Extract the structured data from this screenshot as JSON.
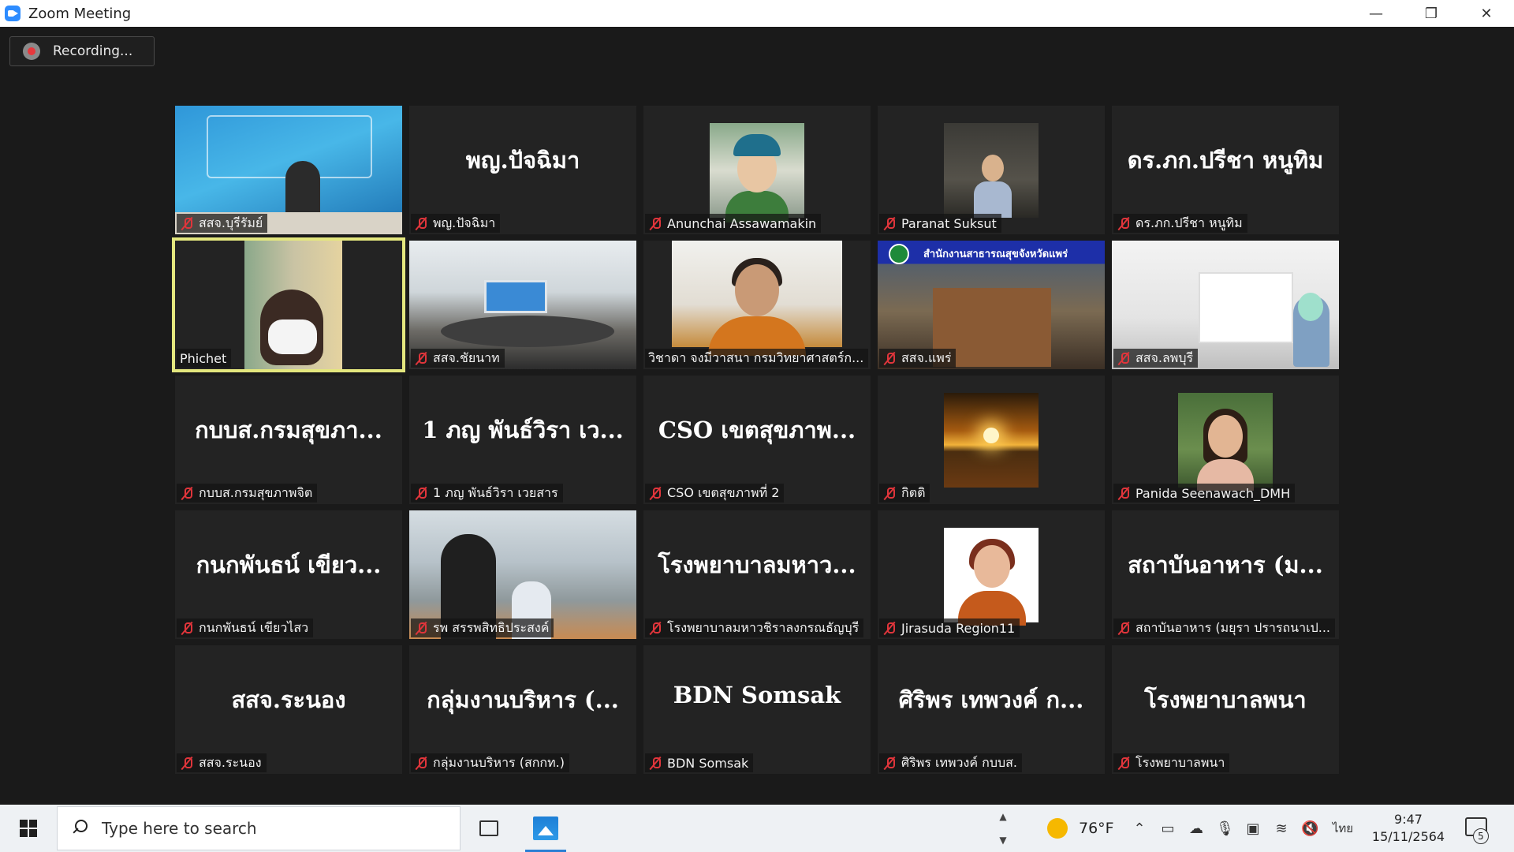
{
  "window": {
    "title": "Zoom Meeting",
    "controls": {
      "minimize": "—",
      "restore": "❐",
      "close": "✕"
    }
  },
  "recording": {
    "label": "Recording..."
  },
  "participants": [
    {
      "display": "",
      "label": "สสจ.บุรีรัมย์",
      "muted": true,
      "video": "phec"
    },
    {
      "display": "พญ.ปัจฉิมา",
      "label": "พญ.ปัจฉิมา",
      "muted": true,
      "video": "none"
    },
    {
      "display": "",
      "label": "Anunchai Assawamakin",
      "muted": true,
      "video": "face"
    },
    {
      "display": "",
      "label": "Paranat Suksut",
      "muted": true,
      "video": "board"
    },
    {
      "display": "ดร.ภก.ปรีชา หนูทิม",
      "label": "ดร.ภก.ปรีชา หนูทิม",
      "muted": true,
      "video": "none"
    },
    {
      "display": "",
      "label": "Phichet",
      "muted": false,
      "video": "phichet",
      "active": true
    },
    {
      "display": "",
      "label": "สสจ.ชัยนาท",
      "muted": true,
      "video": "room1"
    },
    {
      "display": "",
      "label": "วิชาดา จงมีวาสนา กรมวิทยาศาสตร์ก...",
      "muted": false,
      "video": "woman"
    },
    {
      "display": "",
      "label": "สสจ.แพร่",
      "muted": true,
      "video": "room2"
    },
    {
      "display": "",
      "label": "สสจ.ลพบุรี",
      "muted": true,
      "video": "room3"
    },
    {
      "display": "กบบส.กรมสุขภา...",
      "label": "กบบส.กรมสุขภาพจิต",
      "muted": true,
      "video": "none"
    },
    {
      "display": "1 ภญ พันธ์วิรา เว...",
      "label": "1 ภญ พันธ์วิรา เวยสาร",
      "muted": true,
      "video": "none"
    },
    {
      "display": "CSO เขตสุขภาพ...",
      "label": "CSO เขตสุขภาพที่ 2",
      "muted": true,
      "video": "none"
    },
    {
      "display": "",
      "label": "กิตติ",
      "muted": true,
      "video": "sunset"
    },
    {
      "display": "",
      "label": "Panida Seenawach_DMH",
      "muted": true,
      "video": "panida"
    },
    {
      "display": "กนกพันธน์ เขียว...",
      "label": "กนกพันธน์ เขียวไสว",
      "muted": true,
      "video": "none"
    },
    {
      "display": "",
      "label": "รพ สรรพสิทธิประสงค์",
      "muted": true,
      "video": "office"
    },
    {
      "display": "โรงพยาบาลมหาว...",
      "label": "โรงพยาบาลมหาวชิราลงกรณธัญบุรี",
      "muted": true,
      "video": "none"
    },
    {
      "display": "",
      "label": "Jirasuda Region11",
      "muted": true,
      "video": "jirasuda"
    },
    {
      "display": "สถาบันอาหาร (ม...",
      "label": "สถาบันอาหาร (มยุรา ปรารถนาเป...",
      "muted": true,
      "video": "none"
    },
    {
      "display": "สสจ.ระนอง",
      "label": "สสจ.ระนอง",
      "muted": true,
      "video": "none"
    },
    {
      "display": "กลุ่มงานบริหาร (...",
      "label": "กลุ่มงานบริหาร (สกกท.)",
      "muted": true,
      "video": "none"
    },
    {
      "display": "BDN Somsak",
      "label": "BDN Somsak",
      "muted": true,
      "video": "none"
    },
    {
      "display": "ศิริพร เทพวงค์ ก...",
      "label": "ศิริพร เทพวงค์ กบบส.",
      "muted": true,
      "video": "none"
    },
    {
      "display": "โรงพยาบาลพนา",
      "label": "โรงพยาบาลพนา",
      "muted": true,
      "video": "none"
    }
  ],
  "video_text": {
    "phrae_banner": "สำนักงานสาธารณสุขจังหวัดแพร่"
  },
  "taskbar": {
    "search_placeholder": "Type here to search",
    "temperature": "76°F",
    "language": "ไทย",
    "time": "9:47",
    "date": "15/11/2564",
    "notification_count": "5"
  }
}
